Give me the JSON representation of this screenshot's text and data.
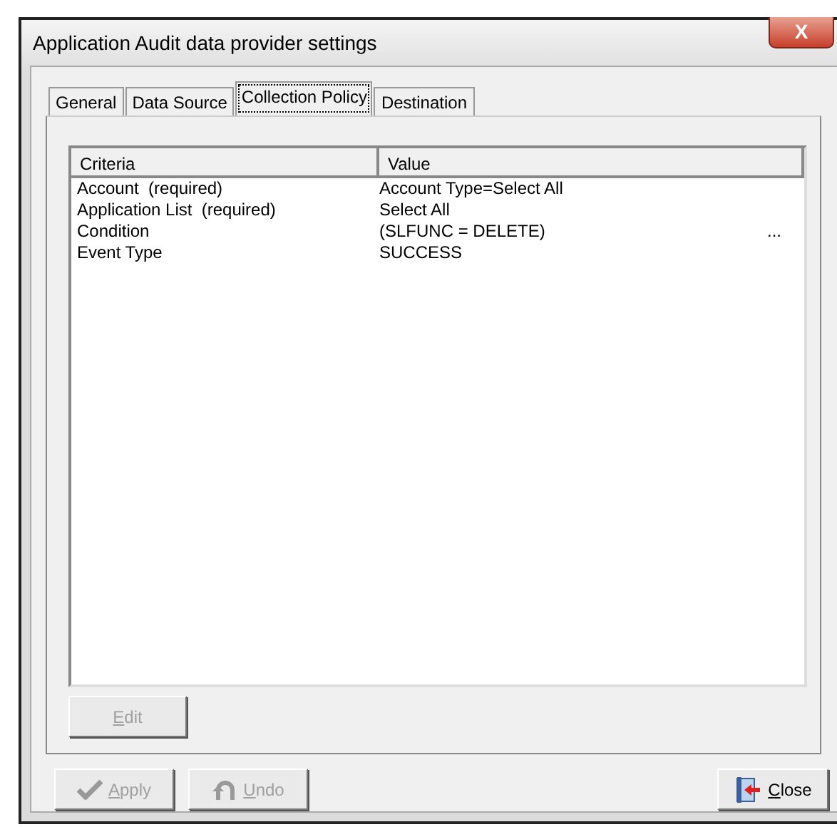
{
  "window": {
    "title": "Application Audit data provider settings",
    "close_glyph": "X"
  },
  "tabs": [
    {
      "label": "General",
      "selected": false
    },
    {
      "label": "Data Source",
      "selected": false
    },
    {
      "label": "Collection Policy",
      "selected": true
    },
    {
      "label": "Destination",
      "selected": false
    }
  ],
  "table": {
    "columns": [
      "Criteria",
      "Value"
    ],
    "rows": [
      {
        "criteria": "Account  (required)",
        "value": "Account Type=Select All"
      },
      {
        "criteria": "Application List  (required)",
        "value": "Select All"
      },
      {
        "criteria": "Condition",
        "value": "(SLFUNC = DELETE)",
        "ellipsis": "..."
      },
      {
        "criteria": "Event Type",
        "value": "SUCCESS"
      }
    ]
  },
  "edit_button": {
    "key": "E",
    "rest": "dit",
    "disabled": true
  },
  "buttons": [
    {
      "kind": "apply",
      "key": "A",
      "rest": "pply",
      "disabled": true
    },
    {
      "kind": "undo",
      "key": "U",
      "rest": "ndo",
      "disabled": true
    },
    {
      "kind": "close",
      "key": "C",
      "rest": "lose",
      "disabled": false
    }
  ]
}
